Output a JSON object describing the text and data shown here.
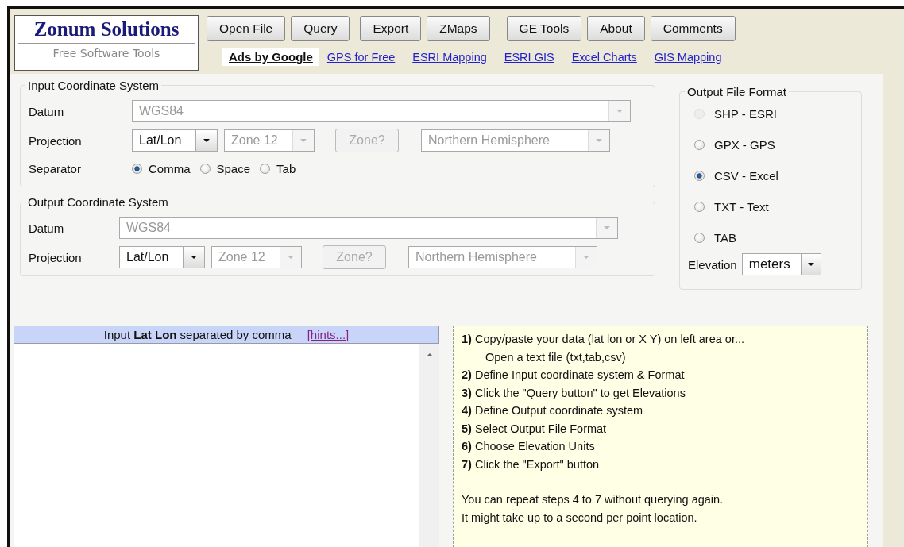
{
  "logo": {
    "title": "Zonum Solutions",
    "subtitle": "Free Software Tools"
  },
  "buttons": [
    "Open File",
    "Query",
    "Export",
    "ZMaps",
    "GE Tools",
    "About",
    "Comments"
  ],
  "ads": {
    "label": "Ads by Google",
    "links": [
      "GPS for Free",
      "ESRI Mapping",
      "ESRI GIS",
      "Excel Charts",
      "GIS Mapping"
    ]
  },
  "input_cs": {
    "legend": "Input Coordinate System",
    "datum": {
      "label": "Datum",
      "value": "WGS84",
      "disabled": true
    },
    "projection": {
      "label": "Projection",
      "value": "Lat/Lon",
      "disabled": false,
      "zone": "Zone 12",
      "zone_disabled": true,
      "zone_button": "Zone?",
      "zone_button_disabled": true,
      "hemisphere": "Northern Hemisphere",
      "hemisphere_disabled": true
    },
    "separator": {
      "label": "Separator",
      "options": [
        {
          "label": "Comma",
          "selected": true
        },
        {
          "label": "Space",
          "selected": false
        },
        {
          "label": "Tab",
          "selected": false
        }
      ]
    }
  },
  "output_cs": {
    "legend": "Output Coordinate System",
    "datum": {
      "label": "Datum",
      "value": "WGS84",
      "disabled": true
    },
    "projection": {
      "label": "Projection",
      "value": "Lat/Lon",
      "disabled": false,
      "zone": "Zone 12",
      "zone_disabled": true,
      "zone_button": "Zone?",
      "zone_button_disabled": true,
      "hemisphere": "Northern Hemisphere",
      "hemisphere_disabled": true
    }
  },
  "output_format": {
    "legend": "Output File Format",
    "options": [
      {
        "label": "SHP - ESRI",
        "selected": false,
        "disabled": true
      },
      {
        "label": "GPX - GPS",
        "selected": false,
        "disabled": false
      },
      {
        "label": "CSV - Excel",
        "selected": true,
        "disabled": false
      },
      {
        "label": "TXT - Text",
        "selected": false,
        "disabled": false
      },
      {
        "label": "TAB",
        "selected": false,
        "disabled": false
      }
    ],
    "elevation": {
      "label": "Elevation",
      "value": "meters"
    }
  },
  "input_panel": {
    "header": "Input **Lat Lon** separated by comma",
    "hints": "[hints...]"
  },
  "instructions": {
    "steps": [
      {
        "text": "**1)** Copy/paste your data (lat lon or X Y) on left area or...",
        "detail": "Open a text file (txt,tab,csv)"
      },
      {
        "text": "**2)** Define Input coordinate system & Format"
      },
      {
        "text": "**3)** Click the \"Query button\" to get Elevations"
      },
      {
        "text": "**4)** Define Output coordinate system"
      },
      {
        "text": "**5)** Select Output File Format"
      },
      {
        "text": "**6)** Choose Elevation Units"
      },
      {
        "text": "**7)** Click the \"Export\" button"
      }
    ],
    "notes": [
      "You can repeat steps 4 to 7 without querying again.",
      "It might take up to a second per point location."
    ]
  }
}
